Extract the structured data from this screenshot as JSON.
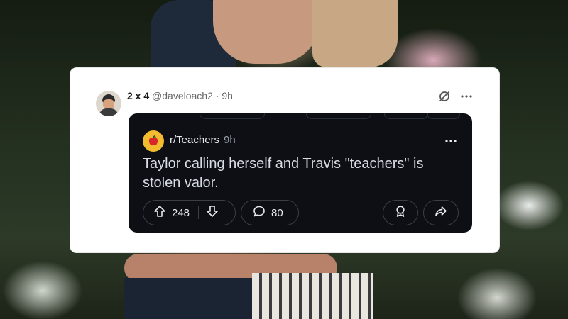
{
  "tweet": {
    "display_name": "2 x 4",
    "handle": "@daveloach2",
    "separator": "·",
    "time": "9h",
    "avatar_icon": "user-avatar-photo",
    "grok_icon": "grok-icon",
    "more_icon": "more-options-icon"
  },
  "reddit": {
    "subreddit": "r/Teachers",
    "time": "9h",
    "subreddit_icon": "apple-icon",
    "title": "Taylor calling herself and Travis \"teachers\" is stolen valor.",
    "upvotes": "248",
    "comments": "80",
    "icons": {
      "upvote": "arrow-up-icon",
      "downvote": "arrow-down-icon",
      "comment": "comment-bubble-icon",
      "award": "award-icon",
      "share": "share-icon",
      "more": "more-options-icon"
    },
    "colors": {
      "background": "#0d0f14",
      "text": "#d8dde4",
      "accent": "#f3bb2f"
    }
  },
  "colors": {
    "frame": "#ffffff"
  }
}
